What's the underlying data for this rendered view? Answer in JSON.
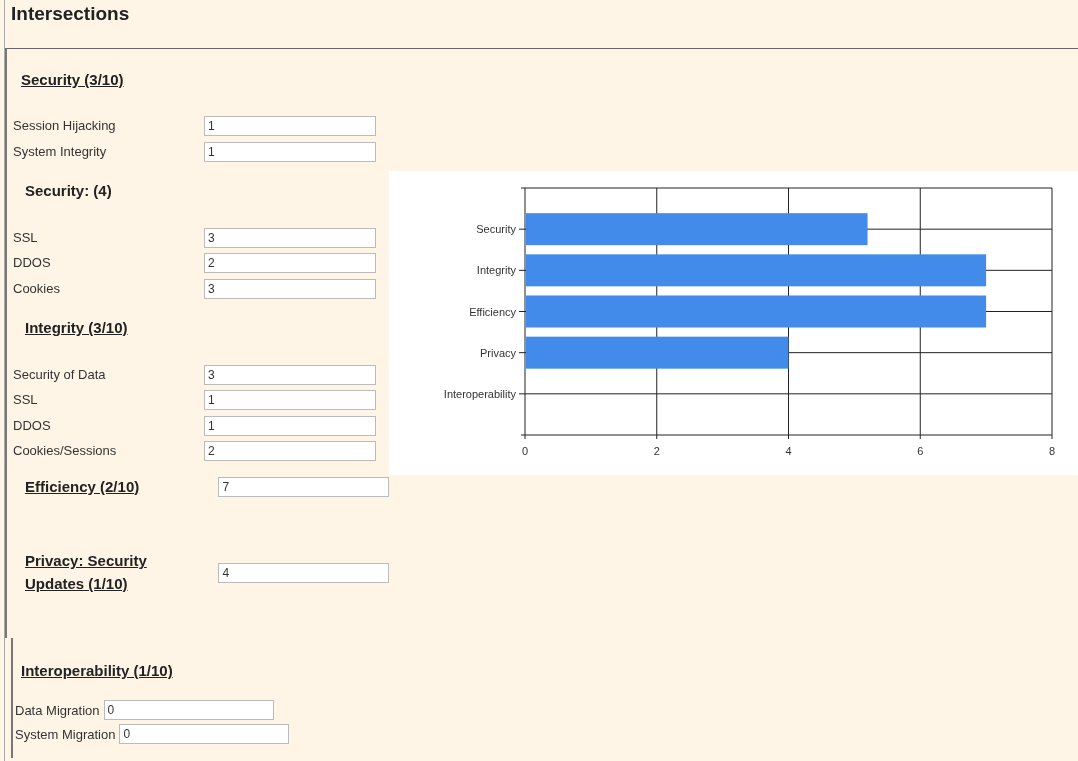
{
  "title": "Intersections",
  "sections": [
    {
      "heading": "Security (3/10)",
      "underlined": true,
      "fields": [
        {
          "label": "Session Hijacking",
          "value": "1"
        },
        {
          "label": "System Integrity",
          "value": "1"
        }
      ]
    },
    {
      "heading": "Security: (4)",
      "underlined": false,
      "fields": [
        {
          "label": "SSL",
          "value": "3"
        },
        {
          "label": "DDOS",
          "value": "2"
        },
        {
          "label": "Cookies",
          "value": "3"
        }
      ]
    },
    {
      "heading": "Integrity (3/10)",
      "underlined": true,
      "fields": [
        {
          "label": "Security of Data",
          "value": "3"
        },
        {
          "label": "SSL",
          "value": "1"
        },
        {
          "label": "DDOS",
          "value": "1"
        },
        {
          "label": "Cookies/Sessions",
          "value": "2"
        }
      ]
    },
    {
      "heading": "Efficiency (2/10)",
      "underlined": true,
      "value": "7"
    },
    {
      "heading": "Privacy: Security Updates (1/10)",
      "underlined": true,
      "value": "4"
    }
  ],
  "lower_section": {
    "heading": "Interoperability (1/10)",
    "underlined": true,
    "fields": [
      {
        "label": "Data Migration",
        "value": "0"
      },
      {
        "label": "System Migration",
        "value": "0"
      }
    ]
  },
  "chart_data": {
    "type": "bar",
    "orientation": "horizontal",
    "categories": [
      "Security",
      "Integrity",
      "Efficiency",
      "Privacy",
      "Interoperability"
    ],
    "series": [
      {
        "color": "#428bea",
        "values": [
          5.2,
          7,
          7,
          4,
          0
        ]
      }
    ],
    "grid": true,
    "xlim": [
      0,
      8
    ],
    "xticks": [
      0,
      2,
      4,
      6,
      8
    ]
  }
}
